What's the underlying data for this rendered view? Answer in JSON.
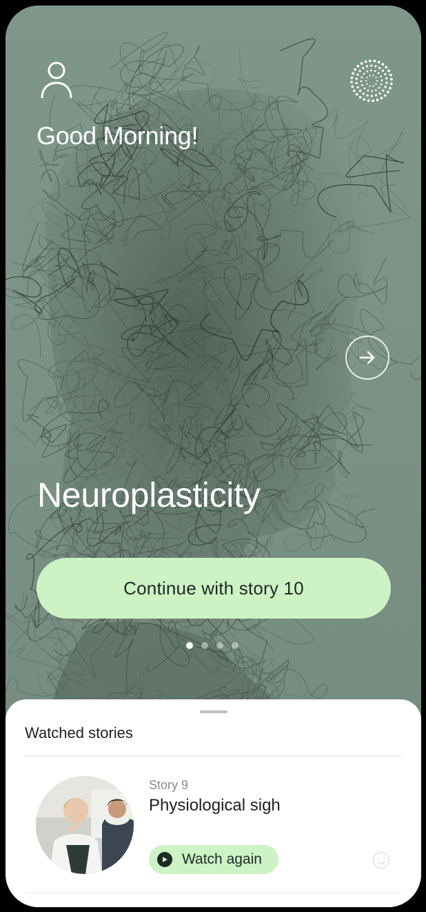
{
  "header": {
    "greeting": "Good Morning!",
    "profile_icon": "user-icon",
    "logo_icon": "dotted-spiral-logo"
  },
  "hero": {
    "title": "Neuroplasticity",
    "next_icon": "arrow-right-icon",
    "cta_label": "Continue with story 10",
    "carousel": {
      "total": 4,
      "active": 1
    },
    "background_color": "#7d9488"
  },
  "watched": {
    "heading": "Watched stories",
    "items": [
      {
        "number_label": "Story 9",
        "title": "Physiological sigh",
        "action_label": "Watch again",
        "action_icon": "play-icon",
        "reaction_icon": "smiley-icon"
      }
    ]
  },
  "colors": {
    "accent": "#cdf2c4",
    "dark": "#1c2a23"
  }
}
